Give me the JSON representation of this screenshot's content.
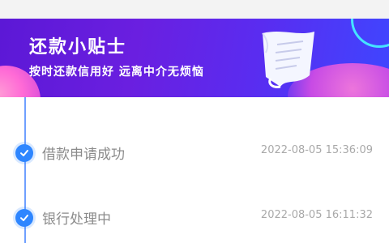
{
  "banner": {
    "title": "还款小贴士",
    "subtitle": "按时还款信用好  远离中介无烦恼"
  },
  "timeline": {
    "steps": [
      {
        "label": "借款申请成功",
        "time": "2022-08-05 15:36:09",
        "status": "completed"
      },
      {
        "label": "银行处理中",
        "time": "2022-08-05 16:11:32",
        "status": "completed"
      }
    ]
  },
  "colors": {
    "banner_start": "#5c18d6",
    "banner_end": "#3f46ff",
    "accent": "#2e86ff",
    "label_text": "#8b8b8b",
    "time_text": "#a9a9a9"
  },
  "icons": [
    "paper-scroll-icon",
    "check-icon"
  ]
}
